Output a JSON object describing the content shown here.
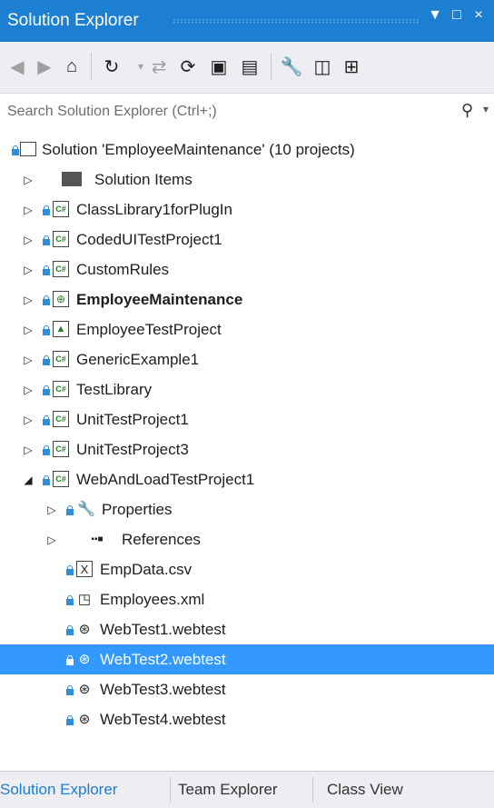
{
  "window": {
    "title": "Solution Explorer",
    "controls": [
      "▼",
      "□",
      "×"
    ]
  },
  "toolbar": {
    "icons": [
      "back-icon",
      "forward-icon",
      "home-icon",
      "history-icon",
      "pending-changes-icon",
      "sync-icon",
      "collapse-all-icon",
      "show-all-files-icon",
      "properties-icon",
      "preview-icon",
      "view-class-diagram-icon"
    ]
  },
  "search": {
    "placeholder": "Search Solution Explorer (Ctrl+;)"
  },
  "tree": {
    "solution": "Solution 'EmployeeMaintenance' (10 projects)",
    "items": [
      {
        "label": "Solution Items",
        "icon": "folder-icon"
      },
      {
        "label": "ClassLibrary1forPlugIn",
        "icon": "csharp-project-icon"
      },
      {
        "label": "CodedUITestProject1",
        "icon": "csharp-project-icon"
      },
      {
        "label": "CustomRules",
        "icon": "csharp-project-icon"
      },
      {
        "label": "EmployeeMaintenance",
        "icon": "web-project-icon"
      },
      {
        "label": "EmployeeTestProject",
        "icon": "test-project-icon"
      },
      {
        "label": "GenericExample1",
        "icon": "csharp-project-icon"
      },
      {
        "label": "TestLibrary",
        "icon": "csharp-project-icon"
      },
      {
        "label": "UnitTestProject1",
        "icon": "csharp-project-icon"
      },
      {
        "label": "UnitTestProject3",
        "icon": "csharp-project-icon"
      },
      {
        "label": "WebAndLoadTestProject1",
        "icon": "csharp-project-icon"
      }
    ],
    "children": [
      {
        "label": "Properties",
        "icon": "wrench-icon"
      },
      {
        "label": "References",
        "icon": "references-icon"
      },
      {
        "label": "EmpData.csv",
        "icon": "csv-file-icon"
      },
      {
        "label": "Employees.xml",
        "icon": "xml-file-icon"
      },
      {
        "label": "WebTest1.webtest",
        "icon": "webtest-file-icon"
      },
      {
        "label": "WebTest2.webtest",
        "icon": "webtest-file-icon"
      },
      {
        "label": "WebTest3.webtest",
        "icon": "webtest-file-icon"
      },
      {
        "label": "WebTest4.webtest",
        "icon": "webtest-file-icon"
      }
    ],
    "csharp_badge": "C#"
  },
  "tabs": [
    "Solution Explorer",
    "Team Explorer",
    "Class View"
  ],
  "colors": {
    "accent": "#1c7fd1",
    "selection": "#3399ff",
    "lock": "#2f8fd6"
  }
}
